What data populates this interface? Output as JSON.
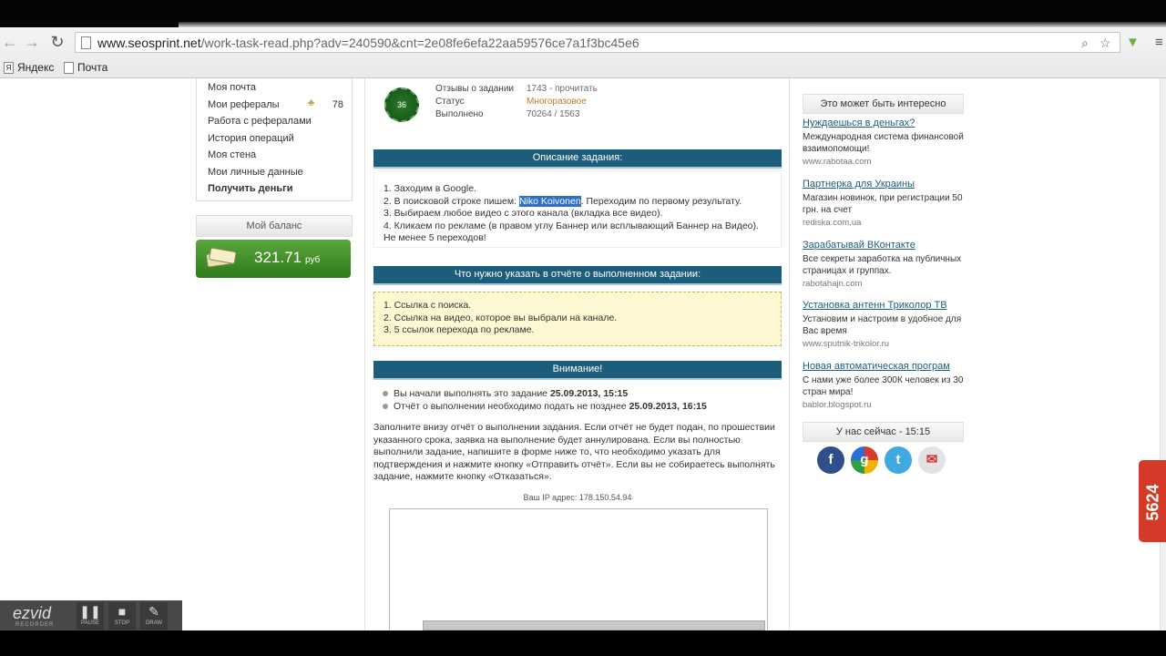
{
  "browser": {
    "url_domain": "www.seosprint.net",
    "url_path": "/work-task-read.php?adv=240590&cnt=2e08fe6efa22aa59576ce7a1f3bc45e6",
    "bookmarks": [
      "Яндекс",
      "Почта"
    ]
  },
  "left_menu": {
    "items": [
      "Моя почта",
      "Мои рефералы",
      "Работа с рефералами",
      "История операций",
      "Моя стена",
      "Мои личные данные",
      "Получить деньги"
    ],
    "referrals_count": "78",
    "balance_label": "Мой баланс",
    "balance_amount": "321.71",
    "balance_currency": "руб"
  },
  "task": {
    "seal_number": "36",
    "info": [
      {
        "label": "Отзывы о задании",
        "value": "1743 - прочитать"
      },
      {
        "label": "Статус",
        "value": "Многоразовое"
      },
      {
        "label": "Выполнено",
        "value": "70264 / 1563"
      }
    ],
    "description_title": "Описание задания:",
    "description": {
      "line1": "1. Заходим в Google.",
      "line2_prefix": "2. В поисковой строке пишем: ",
      "line2_highlight": "Niko Koivonen",
      "line2_suffix": ". Переходим по первому результату.",
      "line3": "3. Выбираем любое видео с этого канала (вкладка все видео).",
      "line4": "4. Кликаем по рекламе (в правом углу Баннер или всплывающий Баннер на Видео).",
      "line5": "Не менее 5 переходов!"
    },
    "report_title": "Что нужно указать в отчёте о выполненном задании:",
    "report_items": [
      "1. Ссылка с поиска.",
      "2. Ссылка на видео, которое вы выбрали на канале.",
      "3. 5 ссылок перехода по рекламе."
    ],
    "attention_title": "Внимание!",
    "attention": [
      {
        "text": "Вы начали выполнять это задание ",
        "date": "25.09.2013, 15:15"
      },
      {
        "text": "Отчёт о выполнении необходимо подать не позднее ",
        "date": "25.09.2013, 16:15"
      }
    ],
    "paragraph": "Заполните внизу отчёт о выполнении задания. Если отчёт не будет подан, по прошествии указанного срока, заявка на выполнение будет аннулирована. Если вы полностью выполнили задание, напишите в форме ниже то, что необходимо указать для подтверждения и нажмите кнопку «Отправить отчёт». Если вы не собираетесь выполнять задание, нажмите кнопку «Отказаться».",
    "ip": "Ваш IP адрес: 178.150.54.94"
  },
  "right_col": {
    "interest_title": "Это может быть интересно",
    "ads": [
      {
        "title": "Нуждаешься в деньгах?",
        "desc": "Международная система финансовой взаимопомощи!",
        "url": "www.rabotaa.com"
      },
      {
        "title": "Партнерка для Украины",
        "desc": "Магазин новинок, при регистрации 50 грн. на счет",
        "url": "rediska.com.ua"
      },
      {
        "title": "Зарабатывай ВКонтакте",
        "desc": "Все секреты заработка на публичных страницах и группах.",
        "url": "rabotahajn.com"
      },
      {
        "title": "Установка антенн Триколор ТВ",
        "desc": "Установим и настроим в удобное для Вас время",
        "url": "www.sputnik-trikolor.ru"
      },
      {
        "title": "Новая автоматическая програм",
        "desc": "С нами уже более 300К человек из 30 стран мира!",
        "url": "bablor.blogspot.ru"
      }
    ],
    "now_title": "У нас сейчас - 15:15"
  },
  "side_badge": "5624",
  "recorder": {
    "logo": "ezvid",
    "sub": "RECORDER",
    "buttons": [
      "PAUSE",
      "STOP",
      "DRAW"
    ]
  }
}
